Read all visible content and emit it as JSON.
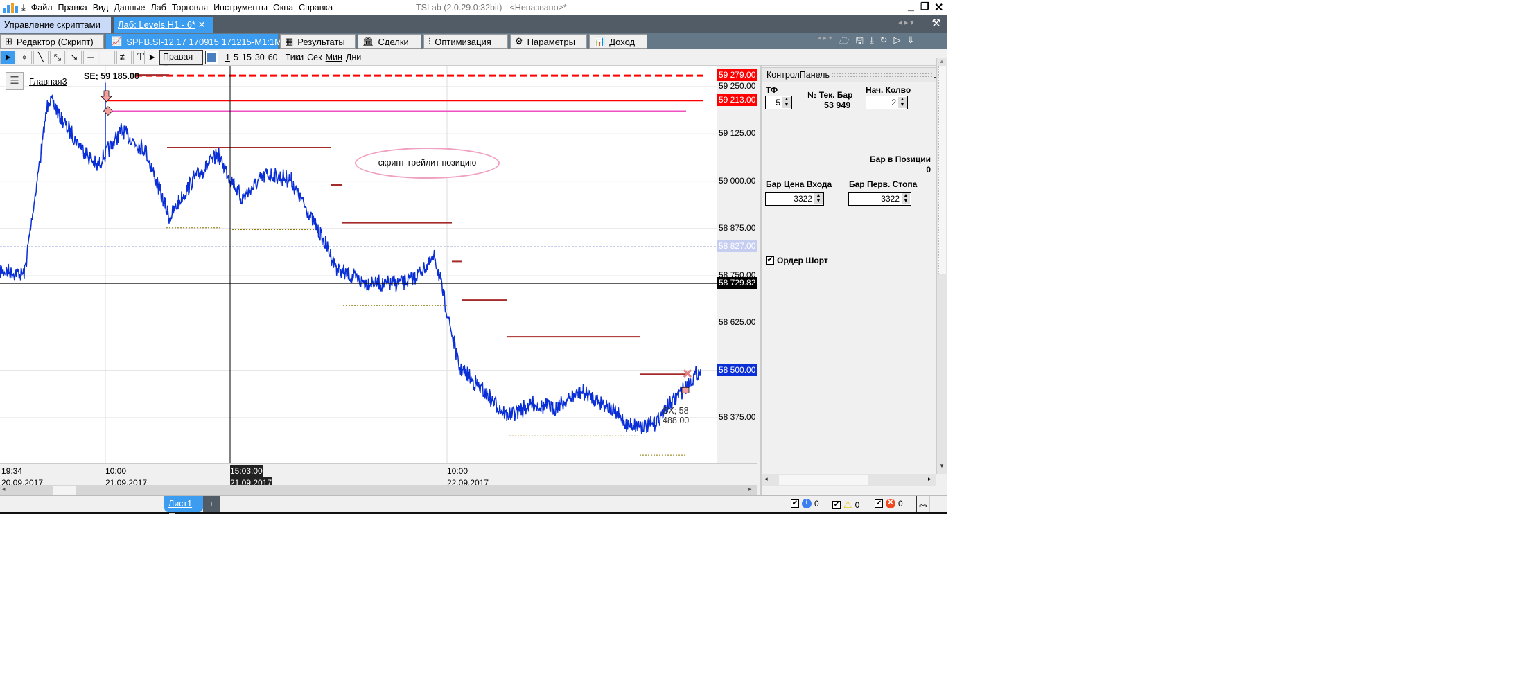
{
  "titlebar": {
    "title": "TSLab (2.0.29.0:32bit) - <Неназвано>*",
    "menu": [
      "Файл",
      "Правка",
      "Вид",
      "Данные",
      "Лаб",
      "Торговля",
      "Инструменты",
      "Окна",
      "Справка"
    ]
  },
  "tabs_top": [
    {
      "label": "Управление скриптами",
      "active": false
    },
    {
      "label": "Лаб: Levels H1 - 6*",
      "active": true
    }
  ],
  "tabs_lab": [
    {
      "label": "Редактор (Скрипт)",
      "icon": "script-editor-icon"
    },
    {
      "label": "SPFB.SI-12.17 170915 171215-M1:1M",
      "icon": "chart-icon",
      "active": true
    },
    {
      "label": "Результаты",
      "icon": "results-icon"
    },
    {
      "label": "Сделки",
      "icon": "deals-icon"
    },
    {
      "label": "Оптимизация",
      "icon": "optimization-icon"
    },
    {
      "label": "Параметры",
      "icon": "gear-icon"
    },
    {
      "label": "Доход",
      "icon": "income-chart-icon"
    }
  ],
  "toolbar": {
    "side_select": "Правая",
    "timeframes": [
      "1",
      "5",
      "15",
      "30",
      "60",
      "Тики",
      "Сек",
      "Мин",
      "Дни"
    ],
    "color": "#4a7fbf"
  },
  "chart": {
    "pane_name": "Главная3",
    "entry_label": "SE; 59 185.00",
    "exit_label": "SX; 58 488.00",
    "annotation": "скрипт трейлит позицию",
    "line_color": "#0a2fd6",
    "price_ticks": [
      "59 250.00",
      "59 125.00",
      "59 000.00",
      "58 875.00",
      "58 750.00",
      "58 625.00",
      "58 500.00",
      "58 375.00"
    ],
    "price_tick_values": [
      59250,
      59125,
      59000,
      58875,
      58750,
      58625,
      58500,
      58375
    ],
    "price_markers": [
      {
        "text": "59 279.00",
        "value": 59279,
        "bg": "#ff0000",
        "fg": "#ffffff"
      },
      {
        "text": "59 213.00",
        "value": 59213,
        "bg": "#ff0000",
        "fg": "#ffffff"
      },
      {
        "text": "58 827.00",
        "value": 58827,
        "bg": "#c5cdf0",
        "fg": "#ffffff"
      },
      {
        "text": "58 729.82",
        "value": 58729.82,
        "bg": "#000000",
        "fg": "#ffffff"
      },
      {
        "text": "58 500.00",
        "value": 58500,
        "bg": "#0a2fd6",
        "fg": "#ffffff"
      }
    ],
    "time_labels": [
      {
        "time": "19:34",
        "date": "20.09.2017"
      },
      {
        "time": "10:00",
        "date": "21.09.2017"
      },
      {
        "time": "15:03:00",
        "date": "21.09.2017",
        "cursor": true
      },
      {
        "time": "10:00",
        "date": "22.09.2017"
      }
    ],
    "prices": [
      58763,
      58755,
      59222,
      59120,
      59038,
      59133,
      59082,
      58903,
      59005,
      59069,
      58954,
      59018,
      59005,
      58890,
      58763,
      58735,
      58727,
      58737,
      58798,
      58508,
      58444,
      58380,
      58411,
      58401,
      58444,
      58413,
      58355,
      58355,
      58431,
      58503
    ],
    "levels": {
      "stop_dashed": 59279,
      "stop": 59213,
      "entry": 59185,
      "last_dotted": 58827,
      "crosshair": 58729.82,
      "trail": [
        59089,
        58990,
        58890,
        58788,
        58686,
        58589,
        58490
      ],
      "min_steps": [
        58877,
        58872,
        58671,
        58327,
        58276
      ]
    }
  },
  "control_panel": {
    "title": "КонтролПанель",
    "tf": {
      "label": "ТФ",
      "value": "5"
    },
    "bar_no": {
      "label": "№  Тек. Бар",
      "value": "53 949"
    },
    "qty": {
      "label": "Нач. Колво",
      "value": "2"
    },
    "bars_in_pos": {
      "label": "Бар в Позиции",
      "value": "0"
    },
    "entry_bar": {
      "label": "Бар Цена Входа",
      "value": "3322"
    },
    "stop_bar": {
      "label": "Бар Перв. Стопа",
      "value": "3322"
    },
    "short_order": {
      "label": "Ордер Шорт",
      "checked": true
    }
  },
  "sheets": {
    "tab": "Лист1",
    "add": "+"
  },
  "status": {
    "info": "0",
    "warn": "0",
    "error": "0"
  }
}
